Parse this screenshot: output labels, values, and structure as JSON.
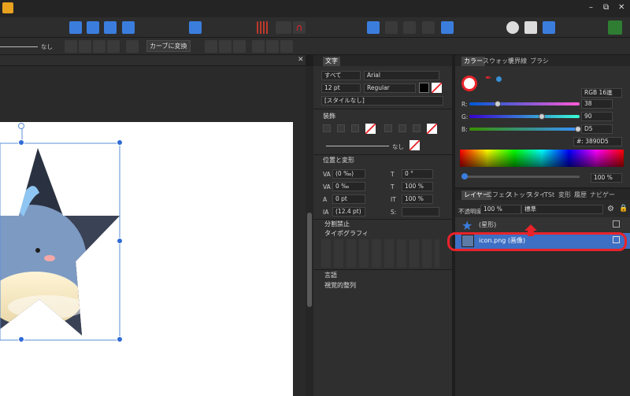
{
  "toolbar2": {
    "none_label": "なし",
    "curve_convert": "カーブに変換"
  },
  "text_panel": {
    "tab": "文字",
    "scope": "すべて",
    "font": "Arial",
    "size": "12 pt",
    "weight": "Regular",
    "style": "[スタイルなし]",
    "decoration_section": "装飾",
    "line_none": "なし",
    "position_section": "位置と変形",
    "kerning": "(0 ‰)",
    "tracking": "0 ‰",
    "baseline": "0 pt",
    "leading": "(12.4 pt)",
    "skew": "0 °",
    "vscale": "100 %",
    "hscale": "100 %",
    "nobreak_section": "分割禁止",
    "typography_section": "タイポグラフィ",
    "language_section": "言語",
    "optical_section": "視覚的整列"
  },
  "color_panel": {
    "tabs": [
      "カラー",
      "スウォッチ",
      "境界線",
      "ブラシ"
    ],
    "mode": "RGB 16進",
    "r_label": "R:",
    "g_label": "G:",
    "b_label": "B:",
    "r": "38",
    "g": "90",
    "b": "D5",
    "hex": "#: 3890D5",
    "opacity": "100 %",
    "fill_color": "#3890D5"
  },
  "layers_panel": {
    "tabs": [
      "レイヤー",
      "エフェク",
      "ストッラ",
      "スタイ",
      "TSt",
      "変形",
      "履歴",
      "ナビゲー"
    ],
    "opacity_label": "不透明度:",
    "opacity": "100 %",
    "blend": "標準",
    "layers": [
      {
        "name": "(星形)"
      },
      {
        "name": "icon.png (画像)"
      }
    ]
  },
  "colors": {
    "accent": "#3b7ddd",
    "highlight": "#e8232a",
    "selection": "#2f6bd6"
  }
}
